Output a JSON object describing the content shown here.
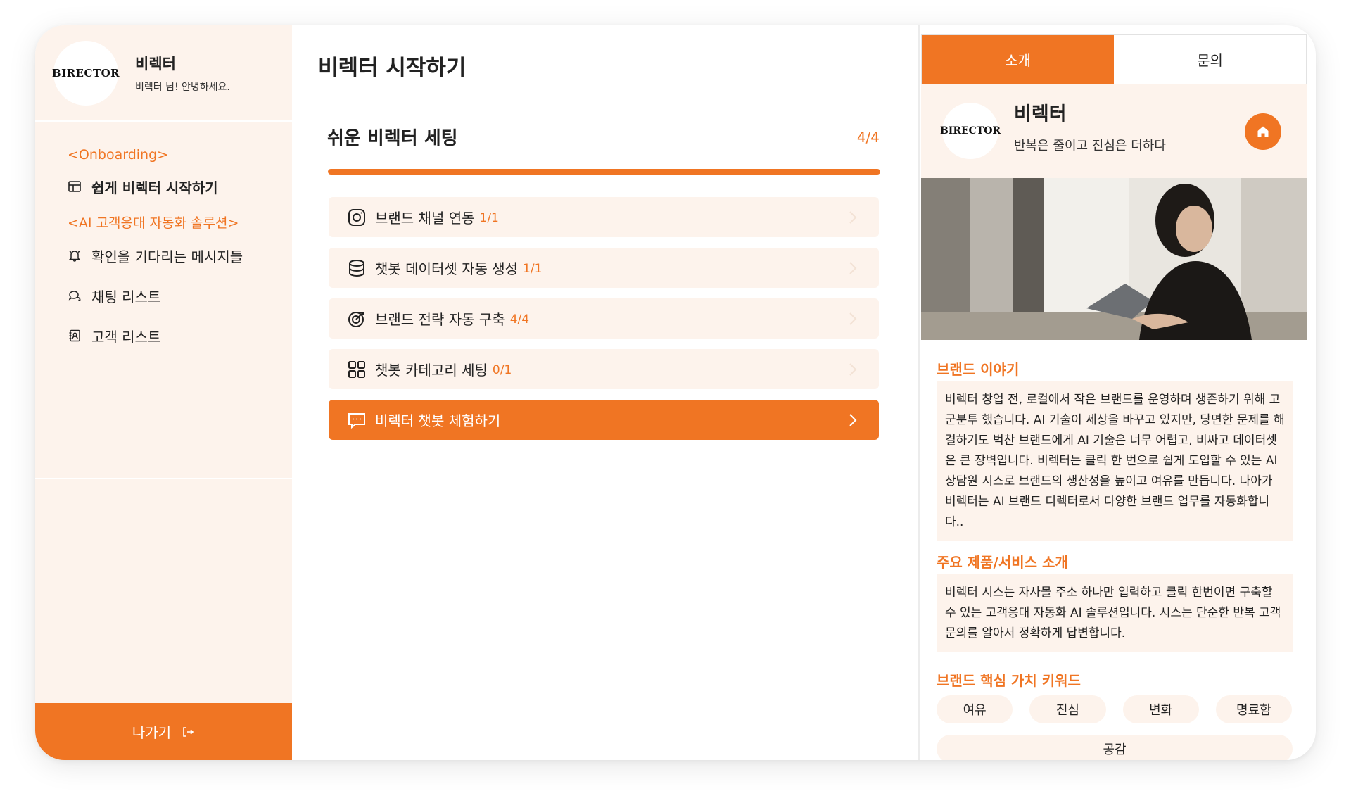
{
  "sidebar": {
    "logo": "BIRECTOR",
    "profile_name": "비렉터",
    "profile_greeting": "비렉터 님! 안녕하세요.",
    "sections": [
      {
        "title": "<Onboarding>"
      },
      {
        "title": "<AI 고객응대 자동화 솔루션>"
      }
    ],
    "items": [
      {
        "label": "쉽게 비렉터 시작하기",
        "icon": "layout-icon"
      },
      {
        "label": "확인을 기다리는 메시지들",
        "icon": "bell-icon"
      },
      {
        "label": "채팅 리스트",
        "icon": "chat-icon"
      },
      {
        "label": "고객 리스트",
        "icon": "contact-icon"
      }
    ],
    "logout_label": "나가기"
  },
  "main": {
    "page_title": "비렉터 시작하기",
    "setup_title": "쉬운 비렉터 세팅",
    "setup_count": "4/4",
    "progress": 1.0,
    "tasks": [
      {
        "label": "브랜드 채널 연동",
        "count": "1/1",
        "icon": "instagram-icon"
      },
      {
        "label": "챗봇 데이터셋 자동 생성",
        "count": "1/1",
        "icon": "database-icon"
      },
      {
        "label": "브랜드 전략 자동 구축",
        "count": "4/4",
        "icon": "target-icon"
      },
      {
        "label": "챗봇 카테고리 세팅",
        "count": "0/1",
        "icon": "grid-icon"
      }
    ],
    "primary_task": {
      "label": "비렉터 챗봇 체험하기",
      "icon": "message-icon"
    }
  },
  "panel": {
    "tabs": [
      {
        "label": "소개",
        "active": true
      },
      {
        "label": "문의",
        "active": false
      }
    ],
    "logo": "BIRECTOR",
    "brand_name": "비렉터",
    "brand_slogan": "반복은 줄이고 진심은 더하다",
    "story_title": "브랜드 이야기",
    "story_text": "비렉터 창업 전, 로컬에서 작은 브랜드를 운영하며 생존하기 위해 고군분투 했습니다. AI 기술이 세상을 바꾸고 있지만, 당면한 문제를 해결하기도 벅찬 브랜드에게 AI 기술은 너무 어렵고, 비싸고 데이터셋은 큰 장벽입니다. 비렉터는 클릭 한 번으로 쉽게 도입할 수 있는 AI 상담원 시스로 브랜드의 생산성을 높이고 여유를 만듭니다. 나아가 비렉터는 AI 브랜드 디렉터로서 다양한 브랜드 업무를 자동화합니다..",
    "product_title": "주요 제품/서비스 소개",
    "product_text": "비렉터 시스는 자사몰 주소 하나만 입력하고 클릭 한번이면 구축할 수 있는 고객응대 자동화 AI 솔루션입니다. 시스는 단순한 반복 고객 문의를 알아서 정확하게 답변합니다.",
    "keywords_title": "브랜드 핵심 가치 키워드",
    "keywords": [
      "여유",
      "진심",
      "변화",
      "명료함"
    ],
    "keyword_more": "공감"
  },
  "colors": {
    "accent": "#f07523",
    "soft": "#fdf3ec"
  }
}
